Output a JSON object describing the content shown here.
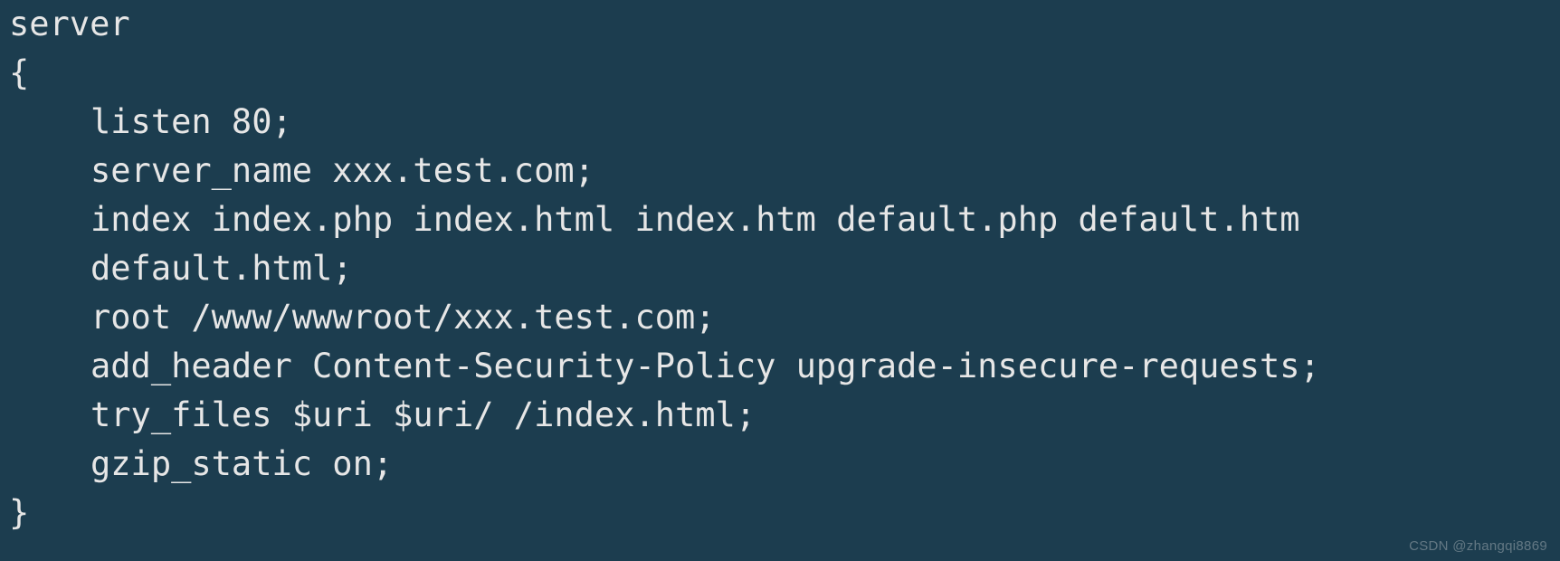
{
  "code": {
    "l1": "server",
    "l2": "{",
    "l3": "listen 80;",
    "l4": "server_name xxx.test.com;",
    "l5": "index index.php index.html index.htm default.php default.htm",
    "l6": "default.html;",
    "l7": "root /www/wwwroot/xxx.test.com;",
    "l8": "add_header Content-Security-Policy upgrade-insecure-requests;",
    "l9": "try_files $uri $uri/ /index.html;",
    "l10": "gzip_static on;",
    "l11": "}"
  },
  "watermark": "CSDN @zhangqi8869"
}
